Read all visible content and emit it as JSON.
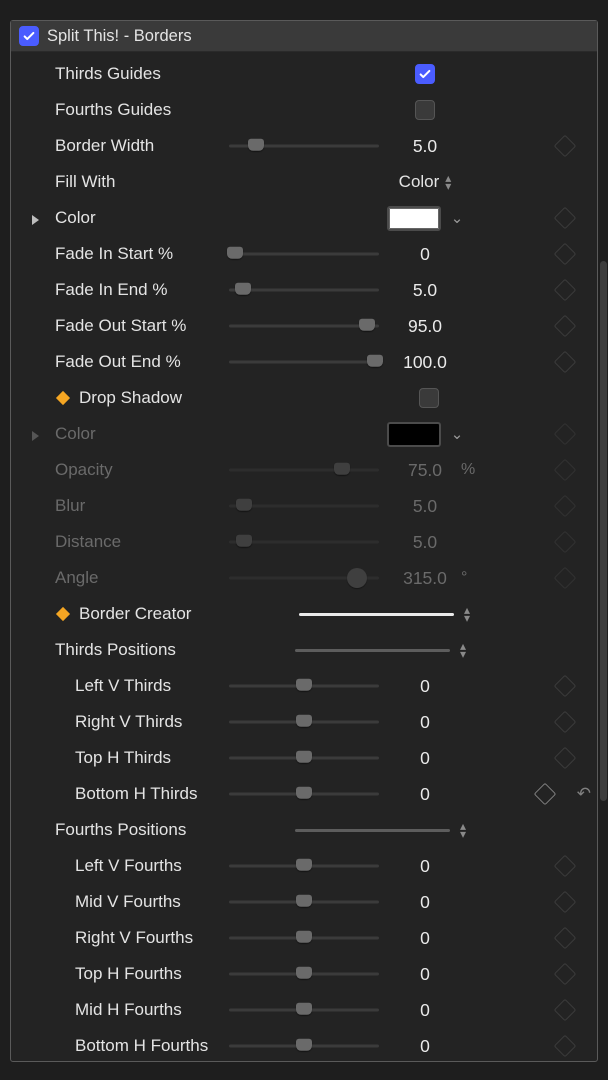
{
  "header": {
    "title": "Split This! - Borders",
    "enabled": true
  },
  "colors": {
    "white": "#ffffff",
    "black": "#000000"
  },
  "rows": {
    "thirds_guides": {
      "label": "Thirds Guides"
    },
    "fourths_guides": {
      "label": "Fourths Guides"
    },
    "border_width": {
      "label": "Border Width",
      "value": "5.0"
    },
    "fill_with": {
      "label": "Fill With",
      "value": "Color"
    },
    "color": {
      "label": "Color"
    },
    "fade_in_start": {
      "label": "Fade In Start %",
      "value": "0"
    },
    "fade_in_end": {
      "label": "Fade In End %",
      "value": "5.0"
    },
    "fade_out_start": {
      "label": "Fade Out Start %",
      "value": "95.0"
    },
    "fade_out_end": {
      "label": "Fade Out End %",
      "value": "100.0"
    },
    "drop_shadow": {
      "label": "Drop Shadow"
    },
    "ds_color": {
      "label": "Color"
    },
    "ds_opacity": {
      "label": "Opacity",
      "value": "75.0",
      "unit": "%"
    },
    "ds_blur": {
      "label": "Blur",
      "value": "5.0"
    },
    "ds_distance": {
      "label": "Distance",
      "value": "5.0"
    },
    "ds_angle": {
      "label": "Angle",
      "value": "315.0",
      "unit": "°"
    },
    "border_creator": {
      "label": "Border Creator"
    },
    "thirds_positions": {
      "label": "Thirds Positions"
    },
    "left_v_thirds": {
      "label": "Left V Thirds",
      "value": "0"
    },
    "right_v_thirds": {
      "label": "Right V Thirds",
      "value": "0"
    },
    "top_h_thirds": {
      "label": "Top H Thirds",
      "value": "0"
    },
    "bottom_h_thirds": {
      "label": "Bottom H Thirds",
      "value": "0"
    },
    "fourths_positions": {
      "label": "Fourths Positions"
    },
    "left_v_fourths": {
      "label": "Left V Fourths",
      "value": "0"
    },
    "mid_v_fourths": {
      "label": "Mid V Fourths",
      "value": "0"
    },
    "right_v_fourths": {
      "label": "Right V Fourths",
      "value": "0"
    },
    "top_h_fourths": {
      "label": "Top H Fourths",
      "value": "0"
    },
    "mid_h_fourths": {
      "label": "Mid H Fourths",
      "value": "0"
    },
    "bottom_h_fourths": {
      "label": "Bottom H Fourths",
      "value": "0"
    }
  }
}
